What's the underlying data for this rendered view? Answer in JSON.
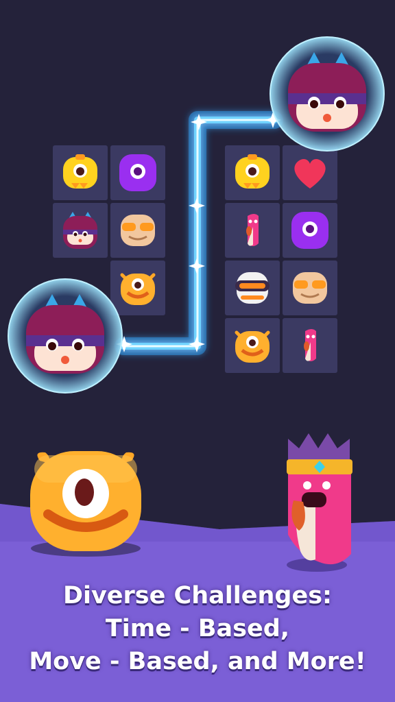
{
  "caption": {
    "line1": "Diverse Challenges:",
    "line2": "Time - Based,",
    "line3": "Move - Based, and More!"
  },
  "colors": {
    "background": "#24223a",
    "tile": "#3b3a62",
    "floor": "#7b5fd6",
    "glow": "#6fd3ff"
  },
  "boards": {
    "left": [
      "yellow-cyclops",
      "purple-blob",
      "ninja-girl",
      "glasses-grandpa",
      "empty",
      "orange-cyclops"
    ],
    "right": [
      "yellow-cyclops",
      "heart",
      "pink-worm",
      "purple-blob",
      "astronaut",
      "glasses-grandpa",
      "orange-cyclops",
      "pink-worm"
    ]
  },
  "selected": [
    "ninja-girl",
    "ninja-girl"
  ],
  "characters": [
    "orange-cyclops-large",
    "king-worm"
  ]
}
